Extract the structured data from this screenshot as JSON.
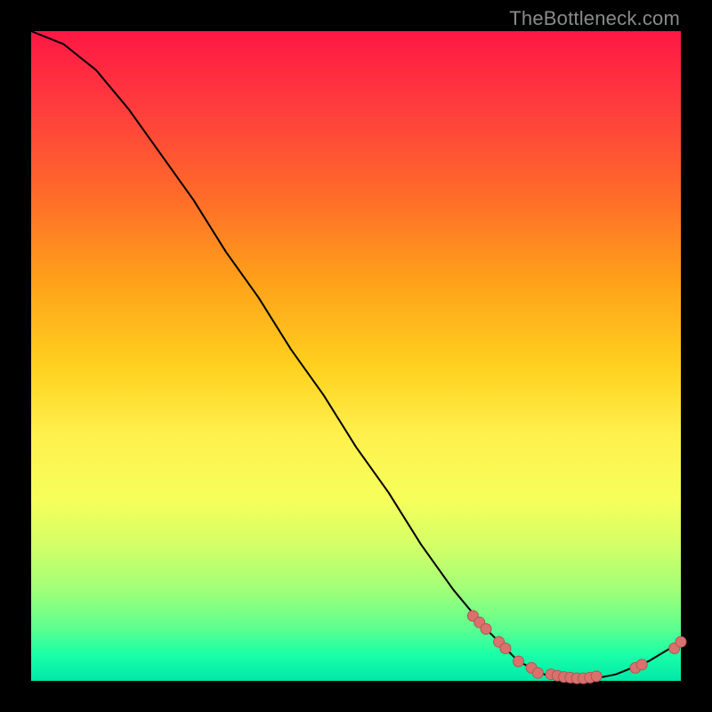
{
  "watermark": "TheBottleneck.com",
  "colors": {
    "curve_stroke": "#000000",
    "marker_fill": "#d9726e",
    "marker_stroke": "#b25651"
  },
  "chart_data": {
    "type": "line",
    "title": "",
    "xlabel": "",
    "ylabel": "",
    "x_range": [
      0,
      100
    ],
    "y_range": [
      0,
      100
    ],
    "curve": [
      {
        "x": 0,
        "y": 100
      },
      {
        "x": 5,
        "y": 98
      },
      {
        "x": 10,
        "y": 94
      },
      {
        "x": 15,
        "y": 88
      },
      {
        "x": 20,
        "y": 81
      },
      {
        "x": 25,
        "y": 74
      },
      {
        "x": 30,
        "y": 66
      },
      {
        "x": 35,
        "y": 59
      },
      {
        "x": 40,
        "y": 51
      },
      {
        "x": 45,
        "y": 44
      },
      {
        "x": 50,
        "y": 36
      },
      {
        "x": 55,
        "y": 29
      },
      {
        "x": 60,
        "y": 21
      },
      {
        "x": 65,
        "y": 14
      },
      {
        "x": 70,
        "y": 8
      },
      {
        "x": 75,
        "y": 3
      },
      {
        "x": 80,
        "y": 0.5
      },
      {
        "x": 85,
        "y": 0
      },
      {
        "x": 90,
        "y": 1
      },
      {
        "x": 95,
        "y": 3
      },
      {
        "x": 100,
        "y": 6
      }
    ],
    "markers": [
      {
        "x": 68,
        "y": 10
      },
      {
        "x": 69,
        "y": 9
      },
      {
        "x": 70,
        "y": 8
      },
      {
        "x": 72,
        "y": 6
      },
      {
        "x": 73,
        "y": 5
      },
      {
        "x": 75,
        "y": 3
      },
      {
        "x": 77,
        "y": 2
      },
      {
        "x": 78,
        "y": 1.2
      },
      {
        "x": 80,
        "y": 1
      },
      {
        "x": 81,
        "y": 0.8
      },
      {
        "x": 82,
        "y": 0.6
      },
      {
        "x": 83,
        "y": 0.5
      },
      {
        "x": 84,
        "y": 0.4
      },
      {
        "x": 85,
        "y": 0.4
      },
      {
        "x": 86,
        "y": 0.5
      },
      {
        "x": 87,
        "y": 0.7
      },
      {
        "x": 93,
        "y": 2
      },
      {
        "x": 94,
        "y": 2.5
      },
      {
        "x": 99,
        "y": 5
      },
      {
        "x": 100,
        "y": 6
      }
    ]
  }
}
